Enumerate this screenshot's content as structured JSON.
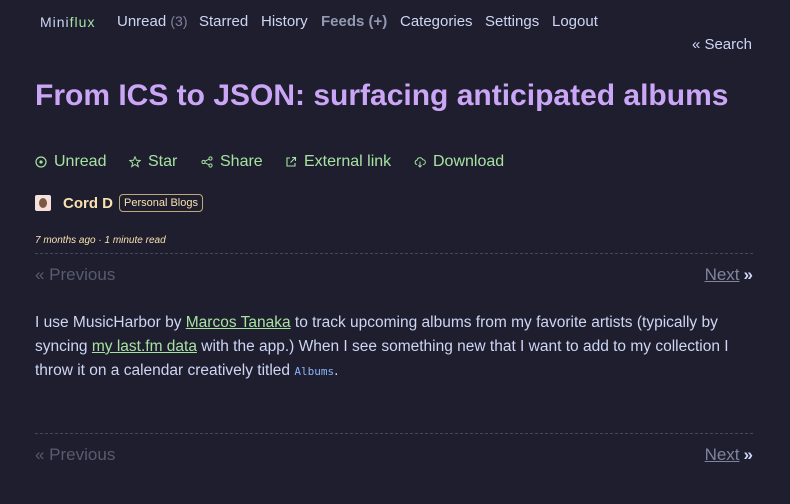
{
  "header": {
    "logo_part1": "Mini",
    "logo_part2": "flux",
    "nav": {
      "unread": "Unread",
      "unread_count": "(3)",
      "starred": "Starred",
      "history": "History",
      "feeds": "Feeds (+)",
      "categories": "Categories",
      "settings": "Settings",
      "logout": "Logout"
    },
    "search": "« Search"
  },
  "entry": {
    "title": "From ICS to JSON: surfacing anticipated albums",
    "actions": {
      "unread": "Unread",
      "star": "Star",
      "share": "Share",
      "external": "External link",
      "download": "Download"
    },
    "author": "Cord D",
    "category": "Personal Blogs",
    "meta": "7 months ago · 1 minute read"
  },
  "pagination": {
    "previous": "« Previous",
    "next": "Next",
    "next_arrow": "»"
  },
  "content": {
    "p1_a": "I use MusicHarbor by ",
    "link1": "Marcos Tanaka",
    "p1_b": " to track upcoming albums from my favorite artists (typically by syncing ",
    "link2": "my last.fm data",
    "p1_c": " with the app.) When I see something new that I want to add to my collection I throw it on a calendar creatively titled ",
    "code1": "Albums",
    "p1_d": "."
  },
  "colors": {
    "background": "#1e1e2e",
    "title": "#cba6f7",
    "accent_green": "#a6e3a1",
    "author_yellow": "#f9e2af"
  }
}
